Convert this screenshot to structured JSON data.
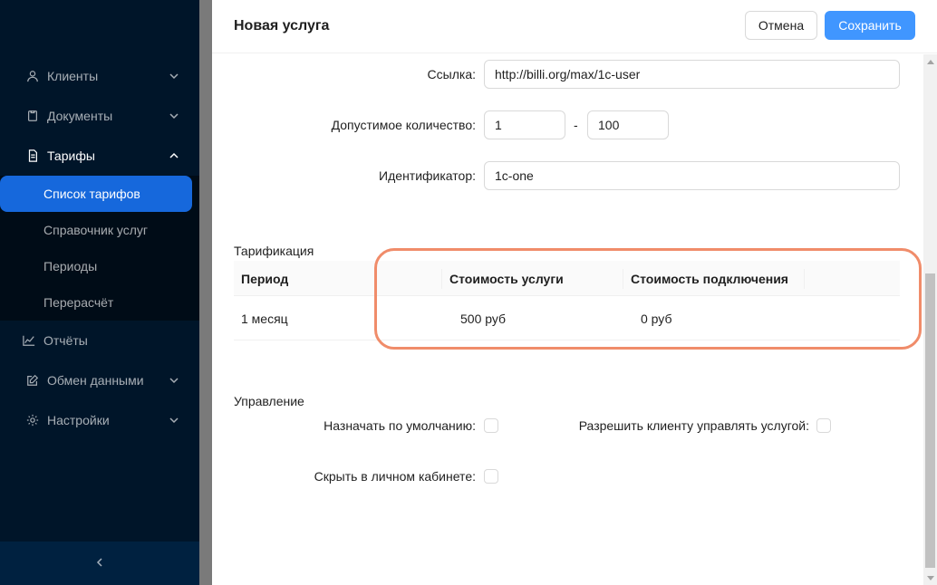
{
  "sidebar": {
    "items": [
      {
        "label": "Клиенты"
      },
      {
        "label": "Документы"
      },
      {
        "label": "Тарифы"
      }
    ],
    "submenu": [
      {
        "label": "Список тарифов"
      },
      {
        "label": "Справочник услуг"
      },
      {
        "label": "Периоды"
      },
      {
        "label": "Перерасчёт"
      }
    ],
    "bottom_items": [
      {
        "label": "Отчёты"
      },
      {
        "label": "Обмен данными"
      },
      {
        "label": "Настройки"
      }
    ],
    "collapse_icon": "chevron-left-icon"
  },
  "drawer": {
    "title": "Новая услуга",
    "cancel_label": "Отмена",
    "save_label": "Сохранить"
  },
  "form": {
    "link_label": "Ссылка:",
    "link_value": "http://billi.org/max/1c-user",
    "quantity_label": "Допустимое количество:",
    "quantity_min": "1",
    "quantity_separator": "-",
    "quantity_max": "100",
    "identifier_label": "Идентификатор:",
    "identifier_value": "1c-one"
  },
  "tariff": {
    "section_title": "Тарификация",
    "columns": [
      "Период",
      "Стоимость услуги",
      "Стоимость подключения"
    ],
    "rows": [
      [
        "1 месяц",
        "500 руб",
        "0 руб"
      ]
    ]
  },
  "management": {
    "section_title": "Управление",
    "default_label": "Назначать по умолчанию:",
    "client_manage_label": "Разрешить клиенту управлять услугой:",
    "hide_label": "Скрыть в личном кабинете:"
  },
  "colors": {
    "sidebar_bg": "#001529",
    "active_item": "#1668dc",
    "primary": "#4096ff",
    "highlight": "#f08c6a"
  }
}
